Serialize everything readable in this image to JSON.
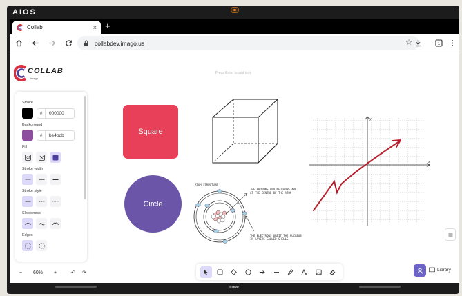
{
  "device": {
    "brand": "AIOS",
    "bottom_label": "imago"
  },
  "browser": {
    "tab_title": "Collab",
    "tab_close": "×",
    "new_tab": "+",
    "url": "collabdev.imago.us"
  },
  "app": {
    "logo_text": "COLLAB",
    "logo_subtext": "imago",
    "canvas_hint": "Press Enter to add text"
  },
  "properties": {
    "stroke_label": "Stroke",
    "stroke_hex": "000000",
    "stroke_color": "#000000",
    "background_label": "Background",
    "background_hex": "be4bdb",
    "background_color": "#8e4ea0",
    "hash": "#",
    "fill_label": "Fill",
    "stroke_width_label": "Stroke width",
    "stroke_style_label": "Stroke style",
    "sloppiness_label": "Sloppiness",
    "edges_label": "Edges"
  },
  "zoom": {
    "minus": "−",
    "value": "60%",
    "plus": "+",
    "undo": "↶",
    "redo": "↷"
  },
  "library": {
    "label": "Library"
  },
  "shapes": {
    "square_label": "Square",
    "square_color": "#e84058",
    "circle_label": "Circle",
    "circle_color": "#6b55a8"
  },
  "atom_sketch": {
    "title": "ATOM STRUCTURE",
    "note1_line1": "THE PROTONS AND NEUTRONS ARE",
    "note1_line2": "AT THE CENTRE OF THE ATOM",
    "note2_line1": "THE ELECTRONS ORBIT THE NUCLEUS",
    "note2_line2": "IN LAYERS CALLED SHELLS"
  },
  "graph_sketch": {
    "x_label": "x",
    "y_label": "y",
    "line_color": "#b5202e"
  }
}
